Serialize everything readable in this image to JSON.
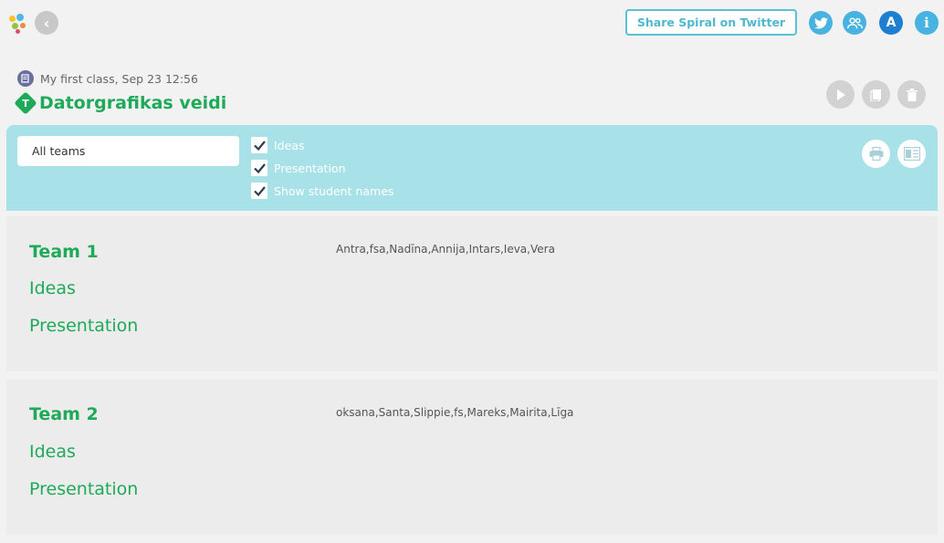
{
  "header": {
    "share_label": "Share Spiral on Twitter",
    "avatar_letter": "A",
    "info_label": "i",
    "back_label": "‹"
  },
  "breadcrumb": {
    "text": "My first class, Sep 23 12:56"
  },
  "page": {
    "title_glyph": "T",
    "title": "Datorgrafikas veidi"
  },
  "filters": {
    "team_select_value": "All teams",
    "checkboxes": [
      {
        "label": "Ideas",
        "checked": true
      },
      {
        "label": "Presentation",
        "checked": true
      },
      {
        "label": "Show student names",
        "checked": true
      }
    ]
  },
  "teams": [
    {
      "name": "Team 1",
      "members": "Antra,fsa,Nadīna,Annija,Intars,Ieva,Vera",
      "items": [
        "Ideas",
        "Presentation"
      ]
    },
    {
      "name": "Team 2",
      "members": "oksana,Santa,Slippie,fs,Mareks,Mairita,Līga",
      "items": [
        "Ideas",
        "Presentation"
      ]
    }
  ],
  "colors": {
    "accent_green": "#1eaa58",
    "filter_bar": "#a8e2e8",
    "share_border": "#5bc1d6",
    "icon_blue": "#48b3e0",
    "avatar_blue": "#1e7fd1"
  },
  "icons": {
    "logo": "spiral-logo-icon",
    "back": "back-arrow-icon",
    "twitter": "twitter-icon",
    "people": "people-icon",
    "play": "play-icon",
    "copy": "copy-icon",
    "delete": "trash-icon",
    "print": "print-icon",
    "export": "export-icon",
    "breadcrumb": "edit-note-icon"
  }
}
